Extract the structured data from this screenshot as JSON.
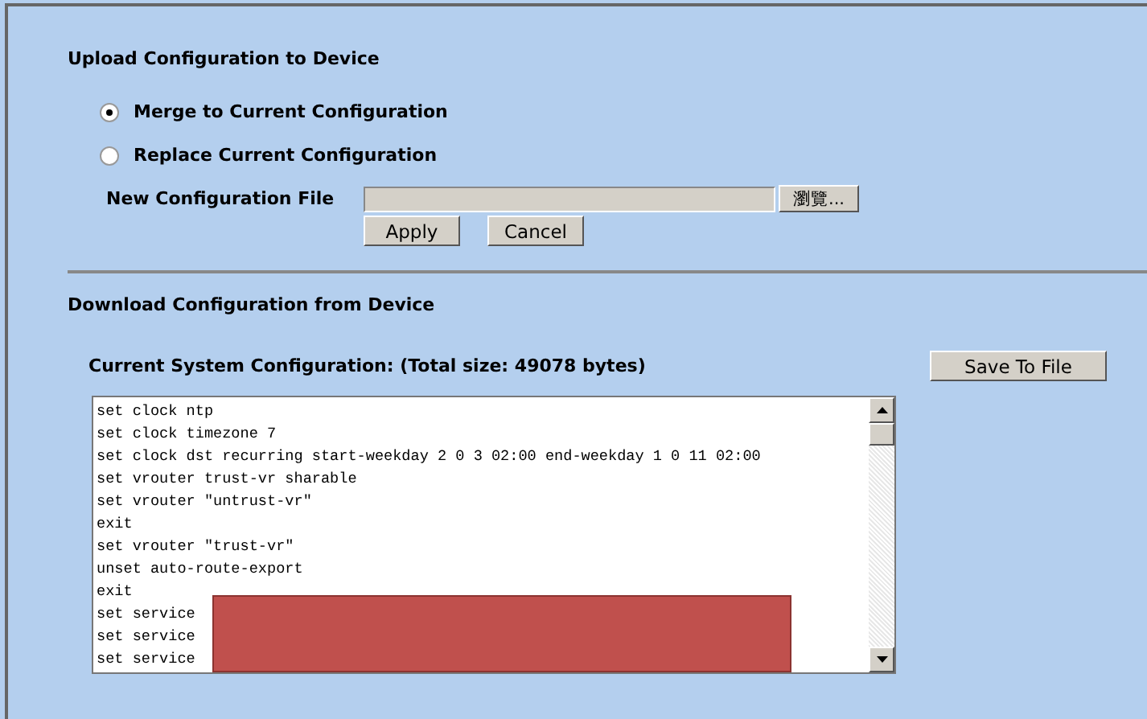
{
  "upload": {
    "title": "Upload Configuration to Device",
    "options": [
      {
        "label": "Merge to Current Configuration",
        "selected": true
      },
      {
        "label": "Replace Current Configuration",
        "selected": false
      }
    ],
    "file_label": "New Configuration File",
    "browse_button": "瀏覽...",
    "buttons": [
      "Apply",
      "Cancel"
    ]
  },
  "download": {
    "title": "Download Configuration from Device",
    "config_label": "Current System Configuration: (Total size: 49078 bytes)",
    "save_button": "Save To File",
    "lines": [
      "set clock ntp",
      "set clock timezone 7",
      "set clock dst recurring start-weekday 2 0 3 02:00 end-weekday 1 0 11 02:00",
      "set vrouter trust-vr sharable",
      "set vrouter \"untrust-vr\"",
      "exit",
      "set vrouter \"trust-vr\"",
      "unset auto-route-export",
      "exit",
      "set service",
      "set service",
      "set service"
    ]
  }
}
